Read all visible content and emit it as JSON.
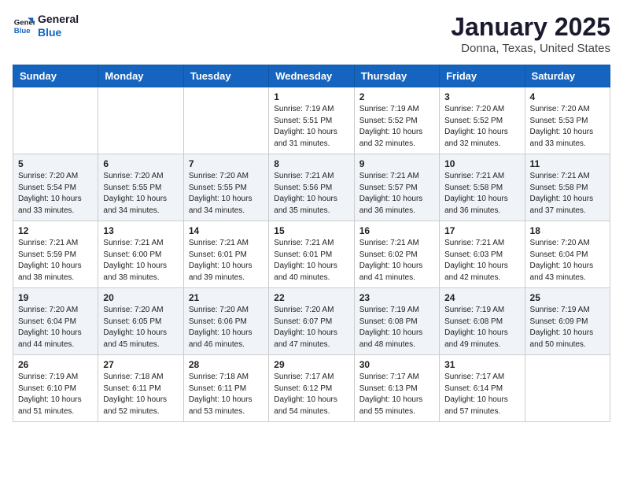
{
  "header": {
    "logo_line1": "General",
    "logo_line2": "Blue",
    "title": "January 2025",
    "subtitle": "Donna, Texas, United States"
  },
  "days_of_week": [
    "Sunday",
    "Monday",
    "Tuesday",
    "Wednesday",
    "Thursday",
    "Friday",
    "Saturday"
  ],
  "weeks": [
    [
      {
        "day": "",
        "info": ""
      },
      {
        "day": "",
        "info": ""
      },
      {
        "day": "",
        "info": ""
      },
      {
        "day": "1",
        "info": "Sunrise: 7:19 AM\nSunset: 5:51 PM\nDaylight: 10 hours\nand 31 minutes."
      },
      {
        "day": "2",
        "info": "Sunrise: 7:19 AM\nSunset: 5:52 PM\nDaylight: 10 hours\nand 32 minutes."
      },
      {
        "day": "3",
        "info": "Sunrise: 7:20 AM\nSunset: 5:52 PM\nDaylight: 10 hours\nand 32 minutes."
      },
      {
        "day": "4",
        "info": "Sunrise: 7:20 AM\nSunset: 5:53 PM\nDaylight: 10 hours\nand 33 minutes."
      }
    ],
    [
      {
        "day": "5",
        "info": "Sunrise: 7:20 AM\nSunset: 5:54 PM\nDaylight: 10 hours\nand 33 minutes."
      },
      {
        "day": "6",
        "info": "Sunrise: 7:20 AM\nSunset: 5:55 PM\nDaylight: 10 hours\nand 34 minutes."
      },
      {
        "day": "7",
        "info": "Sunrise: 7:20 AM\nSunset: 5:55 PM\nDaylight: 10 hours\nand 34 minutes."
      },
      {
        "day": "8",
        "info": "Sunrise: 7:21 AM\nSunset: 5:56 PM\nDaylight: 10 hours\nand 35 minutes."
      },
      {
        "day": "9",
        "info": "Sunrise: 7:21 AM\nSunset: 5:57 PM\nDaylight: 10 hours\nand 36 minutes."
      },
      {
        "day": "10",
        "info": "Sunrise: 7:21 AM\nSunset: 5:58 PM\nDaylight: 10 hours\nand 36 minutes."
      },
      {
        "day": "11",
        "info": "Sunrise: 7:21 AM\nSunset: 5:58 PM\nDaylight: 10 hours\nand 37 minutes."
      }
    ],
    [
      {
        "day": "12",
        "info": "Sunrise: 7:21 AM\nSunset: 5:59 PM\nDaylight: 10 hours\nand 38 minutes."
      },
      {
        "day": "13",
        "info": "Sunrise: 7:21 AM\nSunset: 6:00 PM\nDaylight: 10 hours\nand 38 minutes."
      },
      {
        "day": "14",
        "info": "Sunrise: 7:21 AM\nSunset: 6:01 PM\nDaylight: 10 hours\nand 39 minutes."
      },
      {
        "day": "15",
        "info": "Sunrise: 7:21 AM\nSunset: 6:01 PM\nDaylight: 10 hours\nand 40 minutes."
      },
      {
        "day": "16",
        "info": "Sunrise: 7:21 AM\nSunset: 6:02 PM\nDaylight: 10 hours\nand 41 minutes."
      },
      {
        "day": "17",
        "info": "Sunrise: 7:21 AM\nSunset: 6:03 PM\nDaylight: 10 hours\nand 42 minutes."
      },
      {
        "day": "18",
        "info": "Sunrise: 7:20 AM\nSunset: 6:04 PM\nDaylight: 10 hours\nand 43 minutes."
      }
    ],
    [
      {
        "day": "19",
        "info": "Sunrise: 7:20 AM\nSunset: 6:04 PM\nDaylight: 10 hours\nand 44 minutes."
      },
      {
        "day": "20",
        "info": "Sunrise: 7:20 AM\nSunset: 6:05 PM\nDaylight: 10 hours\nand 45 minutes."
      },
      {
        "day": "21",
        "info": "Sunrise: 7:20 AM\nSunset: 6:06 PM\nDaylight: 10 hours\nand 46 minutes."
      },
      {
        "day": "22",
        "info": "Sunrise: 7:20 AM\nSunset: 6:07 PM\nDaylight: 10 hours\nand 47 minutes."
      },
      {
        "day": "23",
        "info": "Sunrise: 7:19 AM\nSunset: 6:08 PM\nDaylight: 10 hours\nand 48 minutes."
      },
      {
        "day": "24",
        "info": "Sunrise: 7:19 AM\nSunset: 6:08 PM\nDaylight: 10 hours\nand 49 minutes."
      },
      {
        "day": "25",
        "info": "Sunrise: 7:19 AM\nSunset: 6:09 PM\nDaylight: 10 hours\nand 50 minutes."
      }
    ],
    [
      {
        "day": "26",
        "info": "Sunrise: 7:19 AM\nSunset: 6:10 PM\nDaylight: 10 hours\nand 51 minutes."
      },
      {
        "day": "27",
        "info": "Sunrise: 7:18 AM\nSunset: 6:11 PM\nDaylight: 10 hours\nand 52 minutes."
      },
      {
        "day": "28",
        "info": "Sunrise: 7:18 AM\nSunset: 6:11 PM\nDaylight: 10 hours\nand 53 minutes."
      },
      {
        "day": "29",
        "info": "Sunrise: 7:17 AM\nSunset: 6:12 PM\nDaylight: 10 hours\nand 54 minutes."
      },
      {
        "day": "30",
        "info": "Sunrise: 7:17 AM\nSunset: 6:13 PM\nDaylight: 10 hours\nand 55 minutes."
      },
      {
        "day": "31",
        "info": "Sunrise: 7:17 AM\nSunset: 6:14 PM\nDaylight: 10 hours\nand 57 minutes."
      },
      {
        "day": "",
        "info": ""
      }
    ]
  ]
}
